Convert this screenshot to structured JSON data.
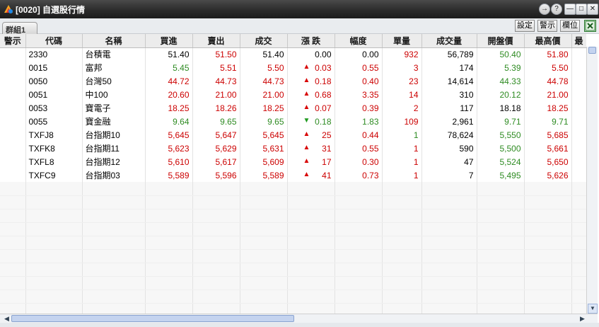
{
  "window": {
    "title": "[0020] 自選股行情",
    "controls": [
      "→",
      "?",
      "—",
      "□",
      "✕"
    ]
  },
  "toolbar": {
    "tab_label": "群組1",
    "settings_label": "設定",
    "alert_label": "警示",
    "columns_label": "欄位",
    "export_icon": "excel-icon"
  },
  "columns": [
    "警示",
    "代碼",
    "名稱",
    "買進",
    "賣出",
    "成交",
    "漲 跌",
    "幅度",
    "單量",
    "成交量",
    "開盤價",
    "最高價",
    "最"
  ],
  "rows": [
    {
      "code": "2330",
      "name": "台積電",
      "bid": "51.40",
      "bid_c": "black",
      "ask": "51.50",
      "ask_c": "red",
      "last": "51.40",
      "last_c": "black",
      "chg": "0.00",
      "chg_c": "black",
      "dir": "",
      "pct": "0.00",
      "pct_c": "black",
      "lot": "932",
      "lot_c": "red",
      "vol": "56,789",
      "open": "50.40",
      "open_c": "green",
      "high": "51.80",
      "high_c": "red"
    },
    {
      "code": "0015",
      "name": "富邦",
      "bid": "5.45",
      "bid_c": "green",
      "ask": "5.51",
      "ask_c": "red",
      "last": "5.50",
      "last_c": "red",
      "chg": "0.03",
      "chg_c": "red",
      "dir": "▲",
      "pct": "0.55",
      "pct_c": "red",
      "lot": "3",
      "lot_c": "red",
      "vol": "174",
      "open": "5.39",
      "open_c": "green",
      "high": "5.50",
      "high_c": "red"
    },
    {
      "code": "0050",
      "name": "台灣50",
      "bid": "44.72",
      "bid_c": "red",
      "ask": "44.73",
      "ask_c": "red",
      "last": "44.73",
      "last_c": "red",
      "chg": "0.18",
      "chg_c": "red",
      "dir": "▲",
      "pct": "0.40",
      "pct_c": "red",
      "lot": "23",
      "lot_c": "red",
      "vol": "14,614",
      "open": "44.33",
      "open_c": "green",
      "high": "44.78",
      "high_c": "red"
    },
    {
      "code": "0051",
      "name": "中100",
      "bid": "20.60",
      "bid_c": "red",
      "ask": "21.00",
      "ask_c": "red",
      "last": "21.00",
      "last_c": "red",
      "chg": "0.68",
      "chg_c": "red",
      "dir": "▲",
      "pct": "3.35",
      "pct_c": "red",
      "lot": "14",
      "lot_c": "red",
      "vol": "310",
      "open": "20.12",
      "open_c": "green",
      "high": "21.00",
      "high_c": "red"
    },
    {
      "code": "0053",
      "name": "寶電子",
      "bid": "18.25",
      "bid_c": "red",
      "ask": "18.26",
      "ask_c": "red",
      "last": "18.25",
      "last_c": "red",
      "chg": "0.07",
      "chg_c": "red",
      "dir": "▲",
      "pct": "0.39",
      "pct_c": "red",
      "lot": "2",
      "lot_c": "red",
      "vol": "117",
      "open": "18.18",
      "open_c": "black",
      "high": "18.25",
      "high_c": "red"
    },
    {
      "code": "0055",
      "name": "寶金融",
      "bid": "9.64",
      "bid_c": "green",
      "ask": "9.65",
      "ask_c": "green",
      "last": "9.65",
      "last_c": "green",
      "chg": "0.18",
      "chg_c": "green",
      "dir": "▼",
      "pct": "1.83",
      "pct_c": "green",
      "lot": "109",
      "lot_c": "red",
      "vol": "2,961",
      "open": "9.71",
      "open_c": "green",
      "high": "9.71",
      "high_c": "green"
    },
    {
      "code": "TXFJ8",
      "name": "台指期10",
      "bid": "5,645",
      "bid_c": "red",
      "ask": "5,647",
      "ask_c": "red",
      "last": "5,645",
      "last_c": "red",
      "chg": "25",
      "chg_c": "red",
      "dir": "▲",
      "pct": "0.44",
      "pct_c": "red",
      "lot": "1",
      "lot_c": "green",
      "vol": "78,624",
      "open": "5,550",
      "open_c": "green",
      "high": "5,685",
      "high_c": "red"
    },
    {
      "code": "TXFK8",
      "name": "台指期11",
      "bid": "5,623",
      "bid_c": "red",
      "ask": "5,629",
      "ask_c": "red",
      "last": "5,631",
      "last_c": "red",
      "chg": "31",
      "chg_c": "red",
      "dir": "▲",
      "pct": "0.55",
      "pct_c": "red",
      "lot": "1",
      "lot_c": "red",
      "vol": "590",
      "open": "5,500",
      "open_c": "green",
      "high": "5,661",
      "high_c": "red"
    },
    {
      "code": "TXFL8",
      "name": "台指期12",
      "bid": "5,610",
      "bid_c": "red",
      "ask": "5,617",
      "ask_c": "red",
      "last": "5,609",
      "last_c": "red",
      "chg": "17",
      "chg_c": "red",
      "dir": "▲",
      "pct": "0.30",
      "pct_c": "red",
      "lot": "1",
      "lot_c": "red",
      "vol": "47",
      "open": "5,524",
      "open_c": "green",
      "high": "5,650",
      "high_c": "red"
    },
    {
      "code": "TXFC9",
      "name": "台指期03",
      "bid": "5,589",
      "bid_c": "red",
      "ask": "5,596",
      "ask_c": "red",
      "last": "5,589",
      "last_c": "red",
      "chg": "41",
      "chg_c": "red",
      "dir": "▲",
      "pct": "0.73",
      "pct_c": "red",
      "lot": "1",
      "lot_c": "red",
      "vol": "7",
      "open": "5,495",
      "open_c": "green",
      "high": "5,626",
      "high_c": "red"
    }
  ],
  "colors": {
    "up": "#cc0000",
    "down": "#2e8b22",
    "titlebar": "#2c2c2c",
    "header_bg": "#ececec"
  }
}
